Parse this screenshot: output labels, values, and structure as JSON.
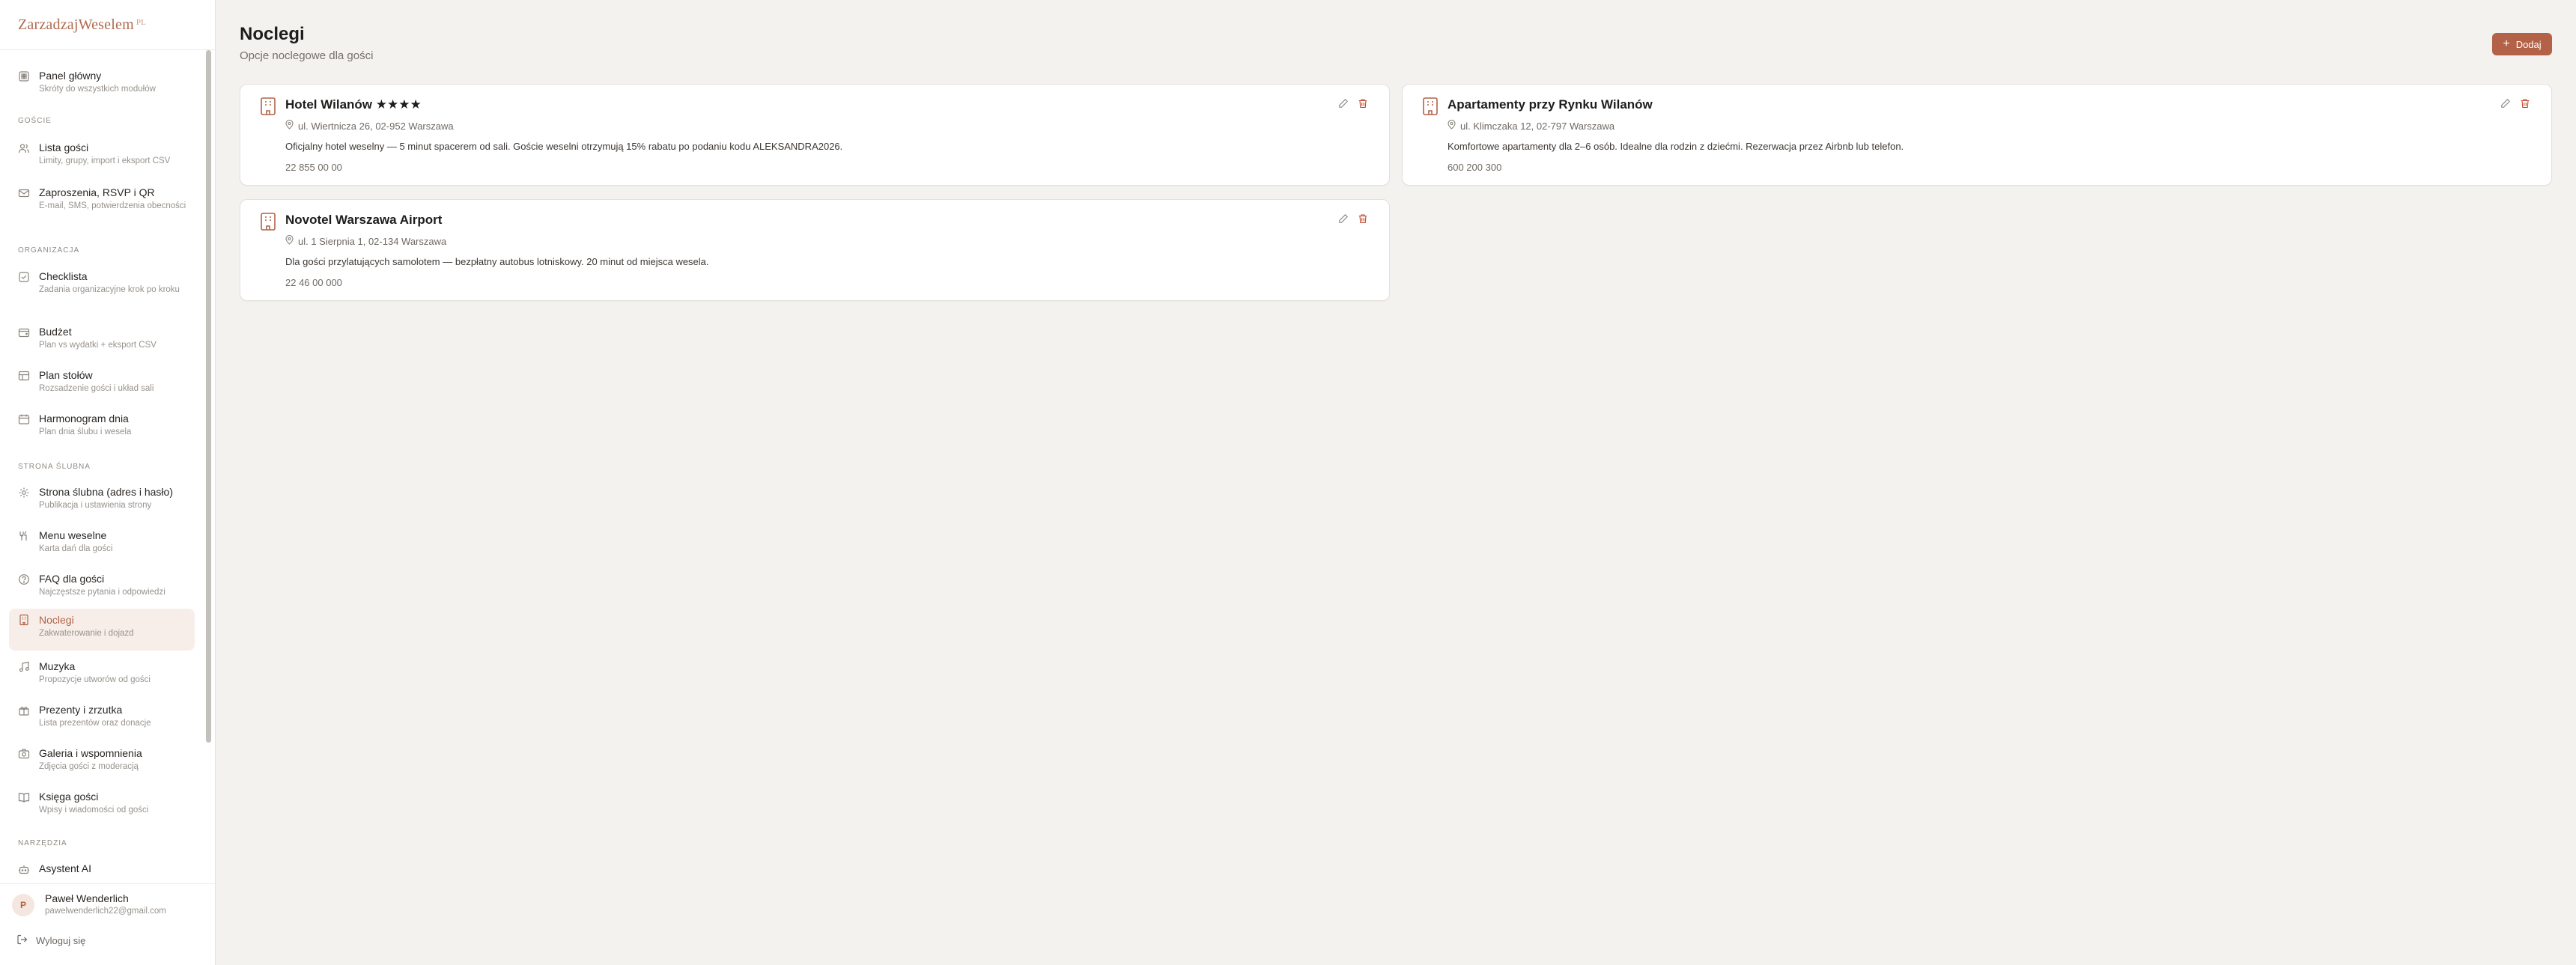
{
  "brand": {
    "name": "ZarzadzajWeselem",
    "suffix": "PL"
  },
  "colors": {
    "accent": "#b36247",
    "background": "#f3f2ef",
    "card": "#ffffff",
    "active_bg": "#f7eeea"
  },
  "sidebar": {
    "sections": {
      "goscie": "GOŚCIE",
      "organizacja": "ORGANIZACJA",
      "strona": "STRONA ŚLUBNA",
      "narzedzia": "NARZĘDZIA"
    },
    "items": [
      {
        "icon": "dashboard-icon",
        "title": "Panel główny",
        "sub": "Skróty do wszystkich modułów"
      },
      {
        "icon": "users-icon",
        "title": "Lista gości",
        "sub": "Limity, grupy, import i eksport CSV"
      },
      {
        "icon": "mail-icon",
        "title": "Zaproszenia, RSVP i QR",
        "sub": "E-mail, SMS, potwierdzenia obecności"
      },
      {
        "icon": "checklist-icon",
        "title": "Checklista",
        "sub": "Zadania organizacyjne krok po kroku"
      },
      {
        "icon": "wallet-icon",
        "title": "Budżet",
        "sub": "Plan vs wydatki + eksport CSV"
      },
      {
        "icon": "table-icon",
        "title": "Plan stołów",
        "sub": "Rozsadzenie gości i układ sali"
      },
      {
        "icon": "calendar-icon",
        "title": "Harmonogram dnia",
        "sub": "Plan dnia ślubu i wesela"
      },
      {
        "icon": "gear-icon",
        "title": "Strona ślubna (adres i hasło)",
        "sub": "Publikacja i ustawienia strony"
      },
      {
        "icon": "utensils-icon",
        "title": "Menu weselne",
        "sub": "Karta dań dla gości"
      },
      {
        "icon": "help-icon",
        "title": "FAQ dla gości",
        "sub": "Najczęstsze pytania i odpowiedzi"
      },
      {
        "icon": "building-icon",
        "title": "Noclegi",
        "sub": "Zakwaterowanie i dojazd",
        "active": true
      },
      {
        "icon": "music-icon",
        "title": "Muzyka",
        "sub": "Propozycje utworów od gości"
      },
      {
        "icon": "gift-icon",
        "title": "Prezenty i zrzutka",
        "sub": "Lista prezentów oraz donacje"
      },
      {
        "icon": "camera-icon",
        "title": "Galeria i wspomnienia",
        "sub": "Zdjęcia gości z moderacją"
      },
      {
        "icon": "book-icon",
        "title": "Księga gości",
        "sub": "Wpisy i wiadomości od gości"
      },
      {
        "icon": "bot-icon",
        "title": "Asystent AI",
        "sub": ""
      }
    ]
  },
  "user": {
    "initial": "P",
    "name": "Paweł Wenderlich",
    "email": "pawelwenderlich22@gmail.com",
    "logout": "Wyloguj się"
  },
  "main": {
    "title": "Noclegi",
    "subtitle": "Opcje noclegowe dla gości",
    "add_label": "Dodaj",
    "cards": [
      {
        "name": "Hotel Wilanów ★★★★",
        "address": "ul. Wiertnicza 26, 02-952 Warszawa",
        "description": "Oficjalny hotel weselny — 5 minut spacerem od sali. Goście weselni otrzymują 15% rabatu po podaniu kodu ALEKSANDRA2026.",
        "phone": "22 855 00 00"
      },
      {
        "name": "Apartamenty przy Rynku Wilanów",
        "address": "ul. Klimczaka 12, 02-797 Warszawa",
        "description": "Komfortowe apartamenty dla 2–6 osób. Idealne dla rodzin z dziećmi. Rezerwacja przez Airbnb lub telefon.",
        "phone": "600 200 300"
      },
      {
        "name": "Novotel Warszawa Airport",
        "address": "ul. 1 Sierpnia 1, 02-134 Warszawa",
        "description": "Dla gości przylatujących samolotem — bezpłatny autobus lotniskowy. 20 minut od miejsca wesela.",
        "phone": "22 46 00 000"
      }
    ]
  }
}
